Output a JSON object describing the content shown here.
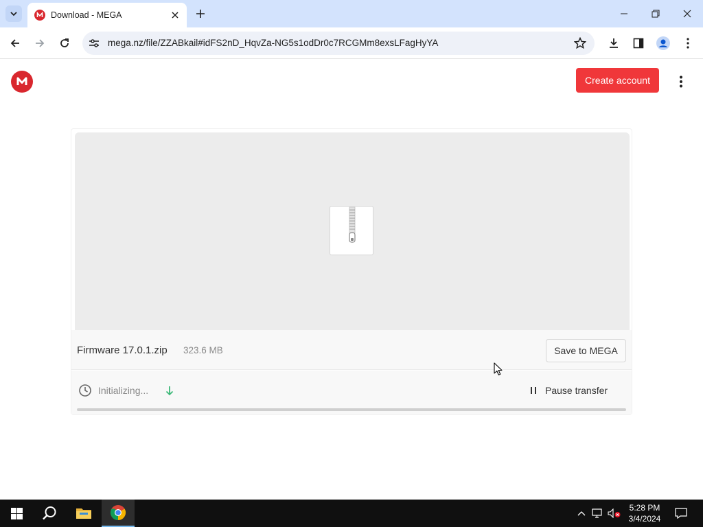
{
  "browser": {
    "tab_title": "Download - MEGA",
    "url": "mega.nz/file/ZZABkail#idFS2nD_HqvZa-NG5s1odDr0c7RCGMm8exsLFagHyYA"
  },
  "header": {
    "create_account_label": "Create account"
  },
  "file": {
    "name": "Firmware 17.0.1.zip",
    "size": "323.6 MB",
    "save_label": "Save to MEGA"
  },
  "transfer": {
    "status": "Initializing...",
    "pause_label": "Pause transfer",
    "progress_fraction": 0
  },
  "taskbar": {
    "time": "5:28 PM",
    "date": "3/4/2024"
  },
  "colors": {
    "mega_red": "#d9272e",
    "create_button": "#f0373a",
    "download_arrow": "#3cb878",
    "tabstrip": "#d3e3fd"
  },
  "icons": [
    "tab-list-icon",
    "mega-favicon",
    "close-icon",
    "plus-icon",
    "minimize-icon",
    "restore-icon",
    "window-close-icon",
    "back-icon",
    "forward-icon",
    "reload-icon",
    "site-settings-icon",
    "star-icon",
    "download-icon",
    "side-panel-icon",
    "profile-icon",
    "menu-icon",
    "mega-logo-icon",
    "kebab-icon",
    "zip-file-icon",
    "clock-icon",
    "arrow-down-icon",
    "pause-icon",
    "windows-start-icon",
    "search-icon",
    "file-explorer-icon",
    "chrome-icon",
    "chevron-up-icon",
    "network-icon",
    "volume-muted-icon",
    "notification-icon"
  ]
}
